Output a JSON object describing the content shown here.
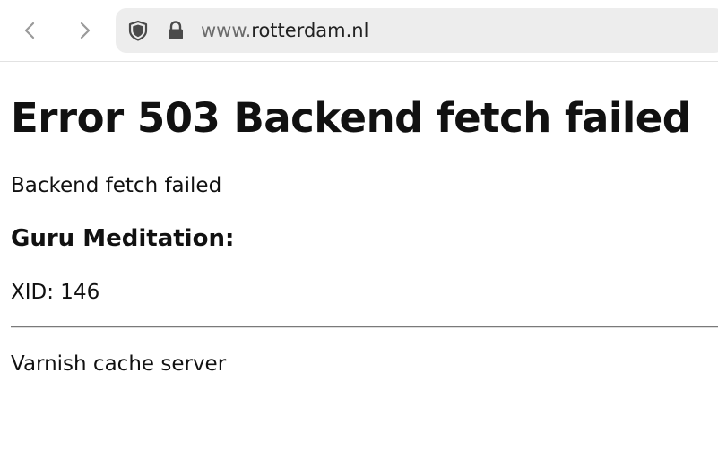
{
  "browser": {
    "url_prefix": "www.",
    "url_host": "rotterdam.nl"
  },
  "page": {
    "title": "Error 503 Backend fetch failed",
    "message": "Backend fetch failed",
    "subheading": "Guru Meditation:",
    "xid": "XID: 146",
    "footer": "Varnish cache server"
  },
  "icons": {
    "back": "chevron-left-icon",
    "forward": "chevron-right-icon",
    "tracking": "shield-icon",
    "security": "lock-icon"
  },
  "colors": {
    "urlbar_bg": "#ededed",
    "icon_color": "#5b5b5b",
    "nav_disabled": "#9a9a9a",
    "text": "#111111",
    "rule": "#7a7a7a"
  }
}
